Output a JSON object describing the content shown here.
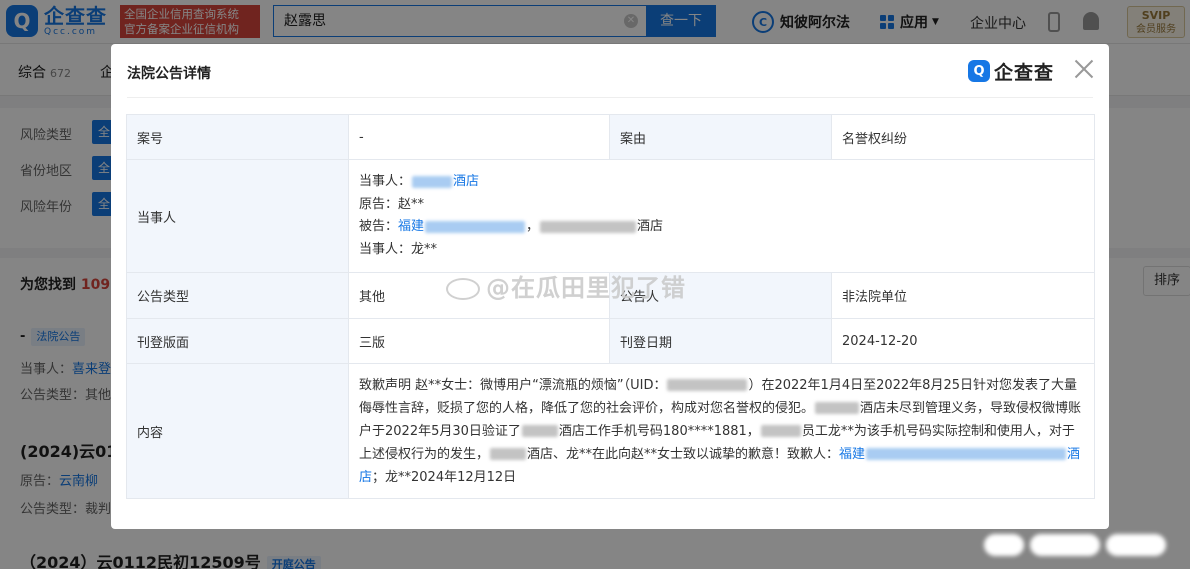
{
  "header": {
    "logo_mark": "Q",
    "logo_cn": "企查查",
    "logo_en": "Qcc.com",
    "slogan_line1": "全国企业信用查询系统",
    "slogan_line2": "官方备案企业征信机构",
    "search_value": "赵露思",
    "search_button": "查一下",
    "ai_link": "知彼阿尔法",
    "app_link": "应用",
    "enterprise_center": "企业中心",
    "svip_line1": "SVIP",
    "svip_line2": "会员服务"
  },
  "subnav": {
    "tab_all": "综合",
    "tab_all_count": "672",
    "tab_second": "企"
  },
  "filters": {
    "risk_type": "风险类型",
    "province": "省份地区",
    "year": "风险年份",
    "chip": "全"
  },
  "results": {
    "found_prefix": "为您找到",
    "found_count": "109",
    "sort": "排序",
    "item1_tag": "法院公告",
    "item1_party_label": "当事人：",
    "item1_party_value": "喜来登",
    "item1_type_label": "公告类型：",
    "item1_type_value": "其他",
    "item2_title": "(2024)云01",
    "item2_plaintiff_label": "原告：",
    "item2_plaintiff_value": "云南柳",
    "item2_type_label": "公告类型：",
    "item2_type_value": "裁判",
    "item3_title": "（2024）云0112民初12509号",
    "item3_tag": "开庭公告"
  },
  "modal": {
    "title": "法院公告详情",
    "brand": "企查查",
    "rows": {
      "case_no_label": "案号",
      "case_no_value": "-",
      "cause_label": "案由",
      "cause_value": "名誉权纠纷",
      "parties_label": "当事人",
      "party1_label": "当事人：",
      "party1_suffix": "酒店",
      "party2": "原告：赵**",
      "party3_label": "被告：",
      "party3_prefix": "福建",
      "party3_sep": "，",
      "party3_suffix": "酒店",
      "party4": "当事人：龙**",
      "type_label": "公告类型",
      "type_value": "其他",
      "announcer_label": "公告人",
      "announcer_value": "非法院单位",
      "page_label": "刊登版面",
      "page_value": "三版",
      "date_label": "刊登日期",
      "date_value": "2024-12-20",
      "content_label": "内容",
      "content_p1": "致歉声明 赵**女士：微博用户“漂流瓶的烦恼”（UID：",
      "content_p2": "）在2022年1月4日至2022年8月25日针对您发表了大量侮辱性言辞，贬损了您的人格，降低了您的社会评价，构成对您名誉权的侵犯。",
      "content_p3": "酒店未尽到管理义务，导致侵权微博账户于2022年5月30日验证了",
      "content_p4": "酒店工作手机号码180****1881，",
      "content_p5": "员工龙**为该手机号码实际控制和使用人，对于上述侵权行为的发生，",
      "content_p6": "酒店、龙**在此向赵**女士致以诚挚的歉意！致歉人：",
      "content_p7": "福建",
      "content_p8": "酒店",
      "content_p9": "；龙**2024年12月12日"
    }
  },
  "watermark": "@在瓜田里犯了错"
}
